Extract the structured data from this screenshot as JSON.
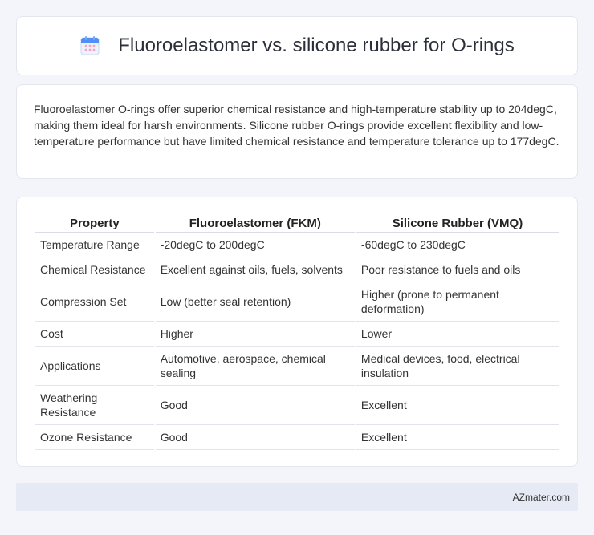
{
  "header": {
    "title": "Fluoroelastomer vs. silicone rubber for O-rings",
    "icon": "calendar-icon"
  },
  "intro": {
    "text": "Fluoroelastomer O-rings offer superior chemical resistance and high-temperature stability up to 204degC, making them ideal for harsh environments. Silicone rubber O-rings provide excellent flexibility and low-temperature performance but have limited chemical resistance and temperature tolerance up to 177degC."
  },
  "table": {
    "headers": [
      "Property",
      "Fluoroelastomer (FKM)",
      "Silicone Rubber (VMQ)"
    ],
    "rows": [
      [
        "Temperature Range",
        "-20degC to 200degC",
        "-60degC to 230degC"
      ],
      [
        "Chemical Resistance",
        "Excellent against oils, fuels, solvents",
        "Poor resistance to fuels and oils"
      ],
      [
        "Compression Set",
        "Low (better seal retention)",
        "Higher (prone to permanent deformation)"
      ],
      [
        "Cost",
        "Higher",
        "Lower"
      ],
      [
        "Applications",
        "Automotive, aerospace, chemical sealing",
        "Medical devices, food, electrical insulation"
      ],
      [
        "Weathering Resistance",
        "Good",
        "Excellent"
      ],
      [
        "Ozone Resistance",
        "Good",
        "Excellent"
      ]
    ]
  },
  "footer": {
    "brand": "AZmater.com"
  },
  "colors": {
    "background": "#f3f5fa",
    "card": "#ffffff",
    "footer": "#e6eaf5",
    "icon_blue": "#4f8ff7",
    "icon_pink": "#f3a5c0"
  }
}
